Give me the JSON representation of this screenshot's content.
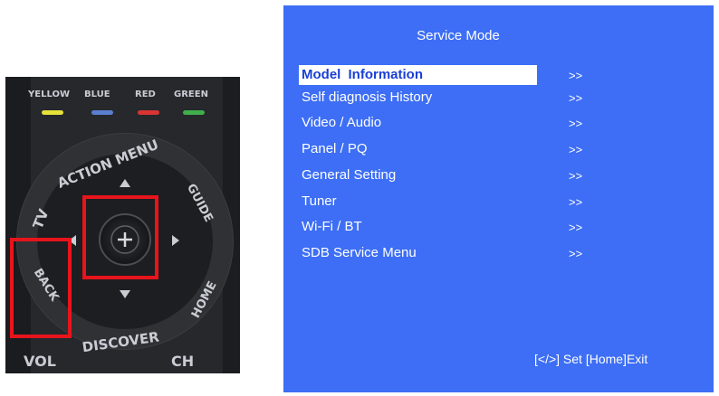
{
  "remote": {
    "color_buttons": [
      "YELLOW",
      "BLUE",
      "RED",
      "GREEN"
    ],
    "action_menu_label": "ACTION MENU",
    "tv_label": "TV",
    "guide_label": "GUIDE",
    "back_label": "BACK",
    "home_label": "HOME",
    "discover_label": "DISCOVER",
    "vol_label": "VOL",
    "ch_label": "CH",
    "highlight_color": "#e8141c"
  },
  "service_menu": {
    "title": "Service Mode",
    "background": "#3d6ef5",
    "items": [
      {
        "label": "Model  Information",
        "arrow": ">>",
        "selected": true
      },
      {
        "label": "Self diagnosis History",
        "arrow": ">>",
        "selected": false
      },
      {
        "label": "Video / Audio",
        "arrow": ">>",
        "selected": false
      },
      {
        "label": "Panel / PQ",
        "arrow": ">>",
        "selected": false
      },
      {
        "label": "General Setting",
        "arrow": ">>",
        "selected": false
      },
      {
        "label": "Tuner",
        "arrow": ">>",
        "selected": false
      },
      {
        "label": "Wi-Fi / BT",
        "arrow": ">>",
        "selected": false
      },
      {
        "label": "SDB Service Menu",
        "arrow": ">>",
        "selected": false
      }
    ],
    "footer": "[</>] Set [Home]Exit"
  }
}
